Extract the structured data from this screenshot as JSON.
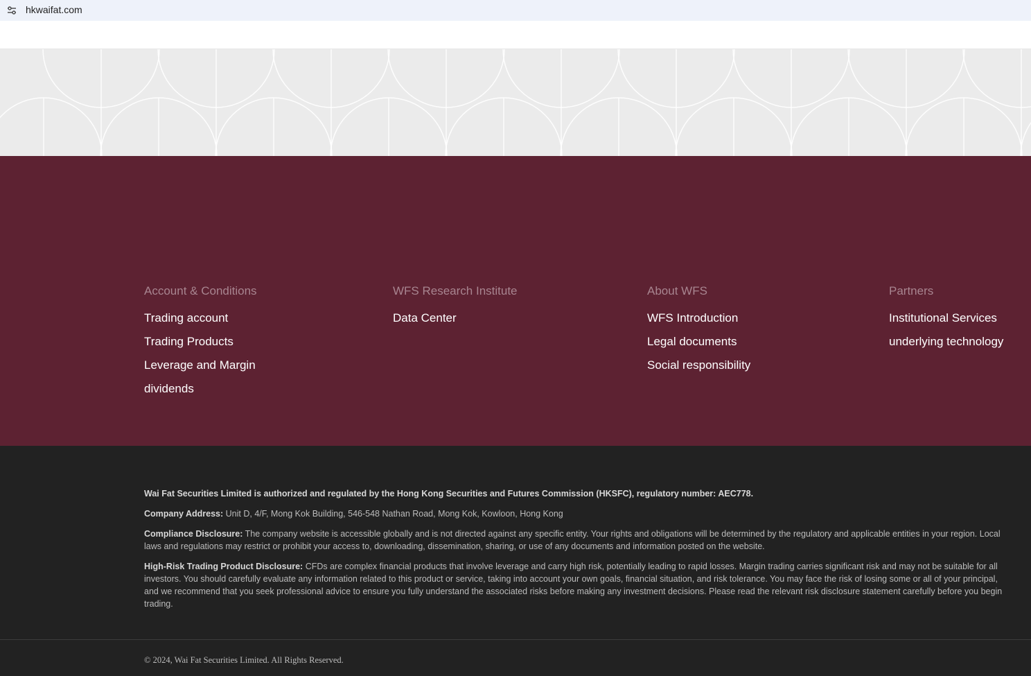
{
  "browser": {
    "url": "hkwaifat.com",
    "site_info_icon": "tune-icon"
  },
  "colors": {
    "pattern_bg": "#ebebeb",
    "links_bg": "#5d2232",
    "legal_bg": "#222222",
    "column_title": "#a88590"
  },
  "footer": {
    "columns": [
      {
        "title": "Account & Conditions",
        "links": [
          "Trading account",
          "Trading Products",
          "Leverage and Margin",
          "dividends"
        ]
      },
      {
        "title": "WFS Research Institute",
        "links": [
          "Data Center"
        ]
      },
      {
        "title": "About WFS",
        "links": [
          "WFS Introduction",
          "Legal documents",
          "Social responsibility"
        ]
      },
      {
        "title": "Partners",
        "links": [
          "Institutional Services",
          "underlying technology"
        ]
      }
    ]
  },
  "legal": {
    "regulation": "Wai Fat Securities Limited is authorized and regulated by the Hong Kong Securities and Futures Commission (HKSFC), regulatory number: AEC778.",
    "address_label": "Company Address:",
    "address": "Unit D, 4/F, Mong Kok Building, 546-548 Nathan Road, Mong Kok, Kowloon, Hong Kong",
    "compliance_label": "Compliance Disclosure:",
    "compliance": "The company website is accessible globally and is not directed against any specific entity. Your rights and obligations will be determined by the regulatory and applicable entities in your region. Local laws and regulations may restrict or prohibit your access to, downloading, dissemination, sharing, or use of any documents and information posted on the website.",
    "risk_label": "High-Risk Trading Product Disclosure:",
    "risk": "CFDs are complex financial products that involve leverage and carry high risk, potentially leading to rapid losses. Margin trading carries significant risk and may not be suitable for all investors. You should carefully evaluate any information related to this product or service, taking into account your own goals, financial situation, and risk tolerance. You may face the risk of losing some or all of your principal, and we recommend that you seek professional advice to ensure you fully understand the associated risks before making any investment decisions. Please read the relevant risk disclosure statement carefully before you begin trading.",
    "copyright": "© 2024, Wai Fat Securities Limited. All Rights Reserved."
  }
}
